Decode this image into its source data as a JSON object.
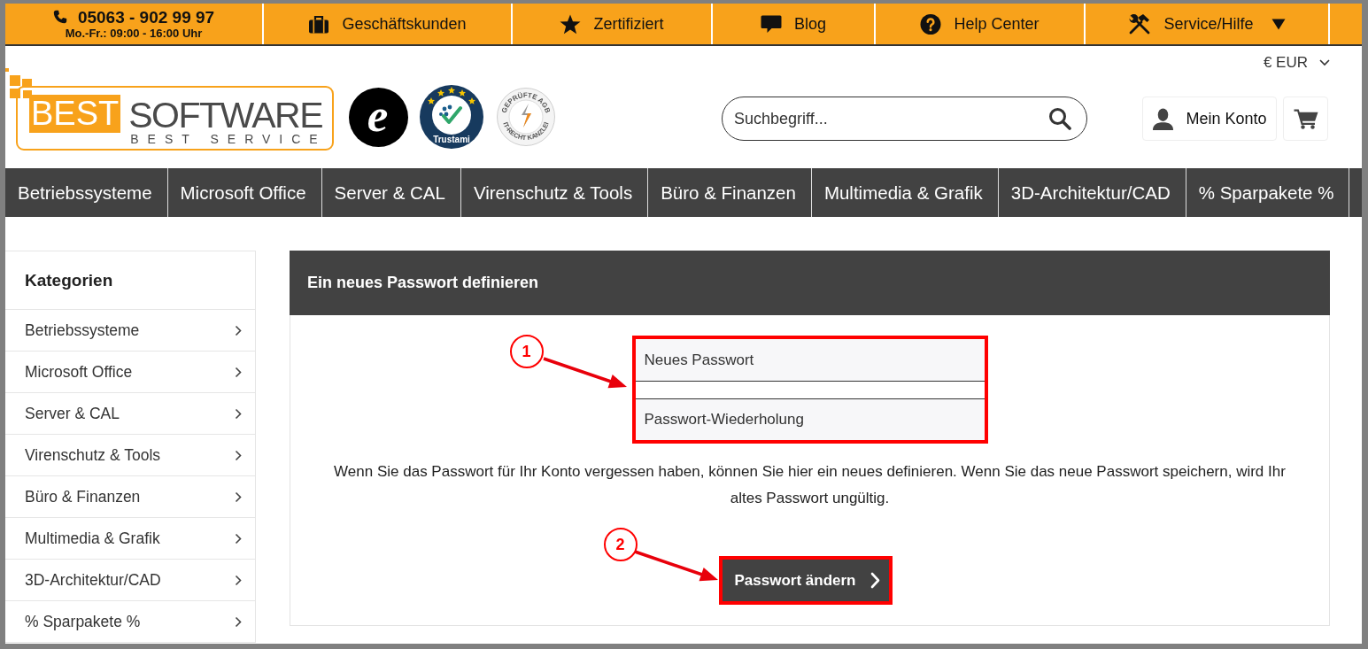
{
  "top_bar": {
    "phone": "05063 - 902 99 97",
    "hours": "Mo.-Fr.: 09:00 - 16:00 Uhr",
    "links": [
      {
        "label": "Geschäftskunden",
        "dropdown": false
      },
      {
        "label": "Zertifiziert",
        "dropdown": false
      },
      {
        "label": "Blog",
        "dropdown": false
      },
      {
        "label": "Help Center",
        "dropdown": false
      },
      {
        "label": "Service/Hilfe",
        "dropdown": true
      }
    ]
  },
  "header": {
    "currency": "€ EUR",
    "logo": {
      "mark": "BEST",
      "name": "SOFTWARE",
      "tagline": "BEST SERVICE"
    },
    "badges": [
      {
        "kind": "letter",
        "text": "e"
      },
      {
        "kind": "rating",
        "text": "Trustami"
      },
      {
        "kind": "seal",
        "text": "GEPRÜFTE AGB",
        "subtext": "IT-RECHT KANZLEI"
      }
    ],
    "search": {
      "placeholder": "Suchbegriff..."
    },
    "account": "Mein Konto"
  },
  "nav": [
    {
      "label": "Betriebssysteme"
    },
    {
      "label": "Microsoft Office"
    },
    {
      "label": "Server & CAL"
    },
    {
      "label": "Virenschutz & Tools"
    },
    {
      "label": "Büro & Finanzen"
    },
    {
      "label": "Multimedia & Grafik"
    },
    {
      "label": "3D-Architektur/CAD"
    },
    {
      "label": "% Sparpakete %"
    }
  ],
  "sidebar": {
    "title": "Kategorien",
    "items": [
      {
        "label": "Betriebssysteme"
      },
      {
        "label": "Microsoft Office"
      },
      {
        "label": "Server & CAL"
      },
      {
        "label": "Virenschutz & Tools"
      },
      {
        "label": "Büro & Finanzen"
      },
      {
        "label": "Multimedia & Grafik"
      },
      {
        "label": "3D-Architektur/CAD"
      },
      {
        "label": "% Sparpakete %"
      }
    ]
  },
  "panel": {
    "title": "Ein neues Passwort definieren",
    "fields": [
      {
        "placeholder": "Neues Passwort"
      },
      {
        "placeholder": "Passwort-Wiederholung"
      }
    ],
    "text": "Wenn Sie das Passwort für Ihr Konto vergessen haben, können Sie hier ein neues definieren. Wenn Sie das neue Passwort speichern, wird Ihr altes Passwort ungültig.",
    "button": "Passwort ändern"
  },
  "annotations": [
    {
      "label": "1"
    },
    {
      "label": "2"
    }
  ]
}
